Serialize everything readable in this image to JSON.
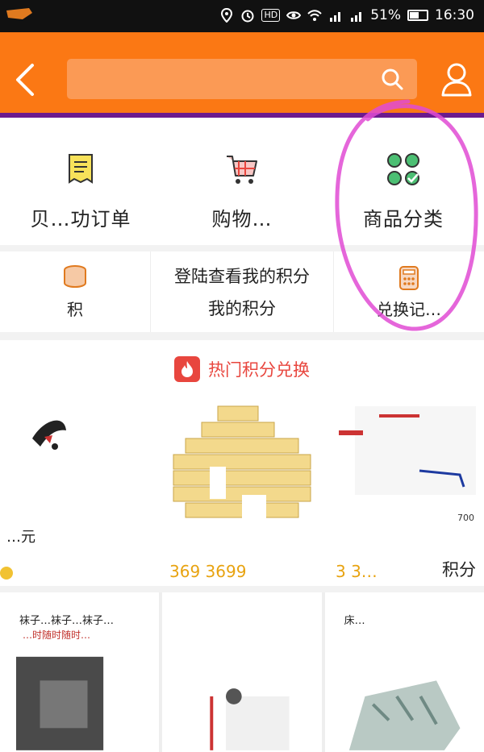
{
  "status_bar": {
    "hd_label": "HD",
    "signal1_label": "4G",
    "signal2_label": "2G",
    "battery": "51%",
    "time": "16:30"
  },
  "header": {
    "search": {
      "placeholder": ""
    }
  },
  "menu": {
    "items": [
      {
        "label": "贝…功订单",
        "icon": "document-icon"
      },
      {
        "label": "购物…",
        "icon": "shopping-cart-icon"
      },
      {
        "label": "商品分类",
        "icon": "category-grid-icon"
      }
    ]
  },
  "points": {
    "left_label": "积",
    "login_text": "登陆查看我的积分",
    "my_points_label": "我的积分",
    "right_label": "兑换记…"
  },
  "hot": {
    "title": "热门积分兑换",
    "products": [
      {
        "name": "…元",
        "points": ""
      },
      {
        "name": "",
        "points": "369 3699"
      },
      {
        "name": "",
        "points": "3 3…",
        "suffix": "积分",
        "tag": "700"
      }
    ]
  },
  "grid": {
    "items": [
      {
        "title": "袜子…袜子…袜子…",
        "subtitle": "…时随时随时…"
      },
      {
        "title": "",
        "subtitle": ""
      },
      {
        "title": "床…",
        "subtitle": ""
      }
    ]
  },
  "colors": {
    "header": "#fb7814",
    "search_bg": "#fb9a55",
    "accent_red": "#e8463e",
    "points_gold": "#e8a310",
    "annotation": "#e04bd4"
  }
}
